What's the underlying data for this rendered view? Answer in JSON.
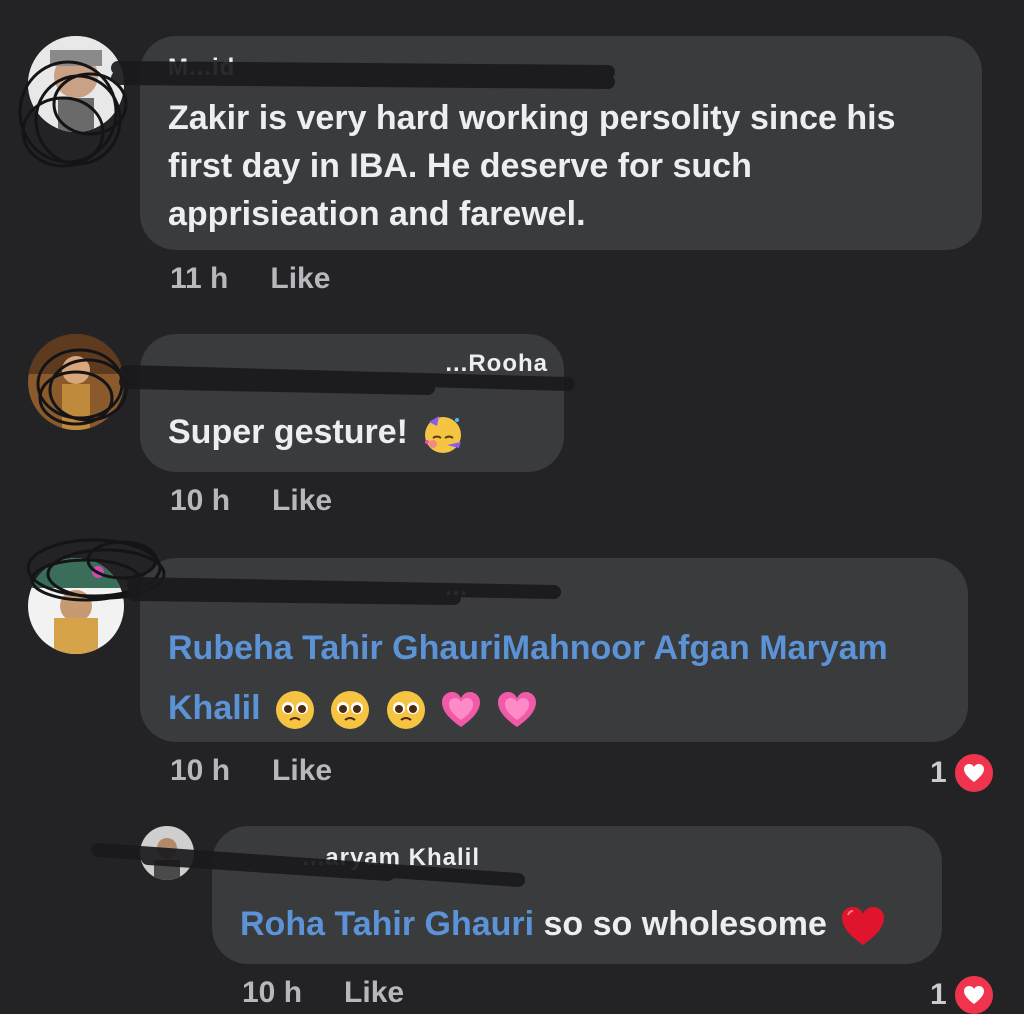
{
  "comments": [
    {
      "author": "M...id",
      "segments": [
        {
          "type": "text",
          "value": "Zakir is  very hard working persolity since his first day in IBA.  He deserve for such apprisieation and farewel."
        }
      ],
      "time": "11 h",
      "like_label": "Like"
    },
    {
      "author": "...Rooha",
      "text": "Super gesture!",
      "emoji": "partying-face-emoji",
      "time": "10 h",
      "like_label": "Like"
    },
    {
      "author": "...",
      "mentions": "Rubeha Tahir GhauriMahnoor Afgan Maryam Khalil",
      "emojis": [
        "pleading-face-emoji",
        "pleading-face-emoji",
        "pleading-face-emoji",
        "growing-heart-emoji",
        "growing-heart-emoji"
      ],
      "time": "10 h",
      "like_label": "Like",
      "reaction_count": "1",
      "reaction_icon": "heart-reaction-icon"
    },
    {
      "author": "...aryam Khalil",
      "mention": "Roha Tahir Ghauri",
      "text": " so so wholesome",
      "emoji": "red-heart-emoji",
      "time": "10 h",
      "like_label": "Like",
      "reaction_count": "1",
      "reaction_icon": "heart-reaction-icon"
    }
  ],
  "colors": {
    "background": "#232326",
    "bubble": "#3a3b3d",
    "text": "#eceef1",
    "mention": "#5c93d6",
    "meta": "#b6b8bd",
    "heart": "#f0344e"
  }
}
